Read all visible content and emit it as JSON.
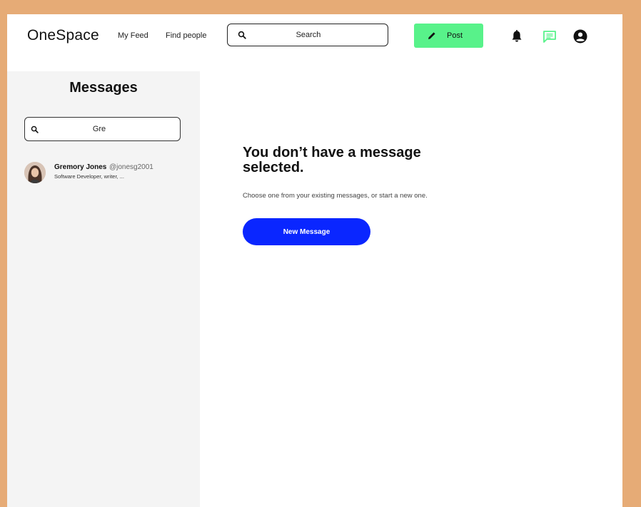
{
  "header": {
    "brand": "OneSpace",
    "nav": [
      {
        "label": "My Feed"
      },
      {
        "label": "Find people"
      }
    ],
    "search": {
      "placeholder": "Search",
      "value": "",
      "icon": "search-icon"
    },
    "post_button": {
      "label": "Post",
      "icon": "pencil-icon"
    },
    "icons": [
      "bell-icon",
      "chat-icon",
      "account-icon"
    ],
    "colors": {
      "post_bg": "#58f28a",
      "chat_icon": "#58f28a"
    }
  },
  "sidebar": {
    "title": "Messages",
    "search": {
      "value": "Gre",
      "icon": "search-icon"
    },
    "contacts": [
      {
        "name": "Gremory Jones",
        "handle": "@jonesg2001",
        "bio": "Software Developer, writer, ..."
      }
    ]
  },
  "main": {
    "empty_title": "You don’t have a message selected.",
    "empty_subtitle": "Choose one from your existing messages, or start a new one.",
    "new_message_label": "New Message",
    "colors": {
      "button_bg": "#0a26ff"
    }
  }
}
